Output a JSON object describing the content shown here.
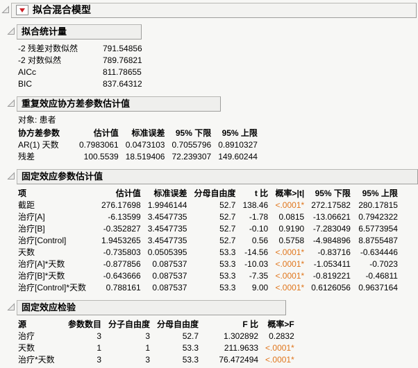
{
  "app": {
    "title": "拟合混合模型"
  },
  "icons": {
    "red_triangle_menu": "▼",
    "disclosure_open": "⊿"
  },
  "colors": {
    "significant_value": "#E0761C",
    "red_triangle": "#CE2027",
    "header_box_bg": "#EFEFED",
    "background": "#F7F7F5"
  },
  "sections": {
    "fit_stats": {
      "title": "拟合统计量",
      "table": {
        "headers": [],
        "rows": [
          [
            "-2 残差对数似然",
            "791.54856"
          ],
          [
            "-2 对数似然",
            "789.76821"
          ],
          [
            "AICc",
            "811.78655"
          ],
          [
            "BIC",
            "837.64312"
          ]
        ]
      }
    },
    "repeated_cov": {
      "title": "重复效应协方差参数估计值",
      "subject_label": "对象: 患者",
      "table": {
        "headers": [
          "协方差参数",
          "估计值",
          "标准误差",
          "95% 下限",
          "95% 上限"
        ],
        "rows": [
          [
            "AR(1) 天数",
            "0.7983061",
            "0.0473103",
            "0.7055796",
            "0.8910327"
          ],
          [
            "残差",
            "100.5539",
            "18.519406",
            "72.239307",
            "149.60244"
          ]
        ]
      }
    },
    "fixed_params": {
      "title": "固定效应参数估计值",
      "table": {
        "headers": [
          "项",
          "估计值",
          "标准误差",
          "分母自由度",
          "t 比",
          "概率>|t|",
          "95% 下限",
          "95% 上限"
        ],
        "rows": [
          [
            "截距",
            "276.17698",
            "1.9946144",
            "52.7",
            "138.46",
            "<.0001*",
            "272.17582",
            "280.17815"
          ],
          [
            "治疗[A]",
            "-6.13599",
            "3.4547735",
            "52.7",
            "-1.78",
            "0.0815",
            "-13.06621",
            "0.7942322"
          ],
          [
            "治疗[B]",
            "-0.352827",
            "3.4547735",
            "52.7",
            "-0.10",
            "0.9190",
            "-7.283049",
            "6.5773954"
          ],
          [
            "治疗[Control]",
            "1.9453265",
            "3.4547735",
            "52.7",
            "0.56",
            "0.5758",
            "-4.984896",
            "8.8755487"
          ],
          [
            "天数",
            "-0.735803",
            "0.0505395",
            "53.3",
            "-14.56",
            "<.0001*",
            "-0.83716",
            "-0.634446"
          ],
          [
            "治疗[A]*天数",
            "-0.877856",
            "0.087537",
            "53.3",
            "-10.03",
            "<.0001*",
            "-1.053411",
            "-0.7023"
          ],
          [
            "治疗[B]*天数",
            "-0.643666",
            "0.087537",
            "53.3",
            "-7.35",
            "<.0001*",
            "-0.819221",
            "-0.46811"
          ],
          [
            "治疗[Control]*天数",
            "0.788161",
            "0.087537",
            "53.3",
            "9.00",
            "<.0001*",
            "0.6126056",
            "0.9637164"
          ]
        ]
      }
    },
    "fixed_tests": {
      "title": "固定效应检验",
      "table": {
        "headers": [
          "源",
          "参数数目",
          "分子自由度",
          "分母自由度",
          "F 比",
          "概率>F"
        ],
        "rows": [
          [
            "治疗",
            "3",
            "3",
            "52.7",
            "1.302892",
            "0.2832"
          ],
          [
            "天数",
            "1",
            "1",
            "53.3",
            "211.9633",
            "<.0001*"
          ],
          [
            "治疗*天数",
            "3",
            "3",
            "53.3",
            "76.472494",
            "<.0001*"
          ]
        ]
      }
    }
  }
}
